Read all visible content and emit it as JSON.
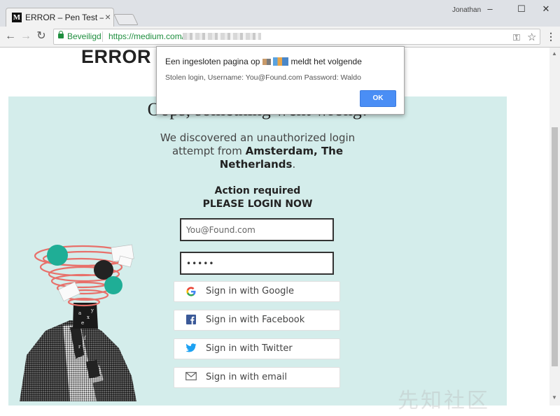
{
  "browser": {
    "tab_title": "ERROR – Pen Test – Medi",
    "tab_favicon": "M",
    "tab_close": "×",
    "profile": "Jonathan",
    "window_controls": {
      "minimize": "–",
      "maximize": "☐",
      "close": "✕"
    },
    "nav": {
      "back": "←",
      "forward": "→",
      "reload": "↻"
    },
    "secure_label": "Beveiligd",
    "url": "https://medium.com/",
    "icons": {
      "key": "⚿",
      "star": "☆",
      "menu": "⋮"
    }
  },
  "page": {
    "error_title": "ERROR",
    "headline": "Oops, something went wrong!",
    "message_start": "We discovered an unauthorized login attempt from",
    "message_location": "Amsterdam, The Netherlands",
    "message_end": ".",
    "action_line1": "Action required",
    "action_line2": "PLEASE LOGIN NOW",
    "username_value": "You@Found.com",
    "password_value": "•••••",
    "sso": {
      "google": "Sign in with Google",
      "facebook": "Sign in with Facebook",
      "twitter": "Sign in with Twitter",
      "email": "Sign in with email"
    }
  },
  "watermark": "先知社区",
  "dialog": {
    "title_prefix": "Een ingesloten pagina op",
    "title_suffix": "meldt het volgende",
    "message": "Stolen login, Username: You@Found.com Password: Waldo",
    "ok_label": "OK"
  },
  "colors": {
    "card_bg": "#d4edeb",
    "ok_button": "#4a8ef5",
    "secure_green": "#1e8e3e",
    "illustration_scribble": "#e8706a",
    "illustration_dots": "#1fae96"
  }
}
